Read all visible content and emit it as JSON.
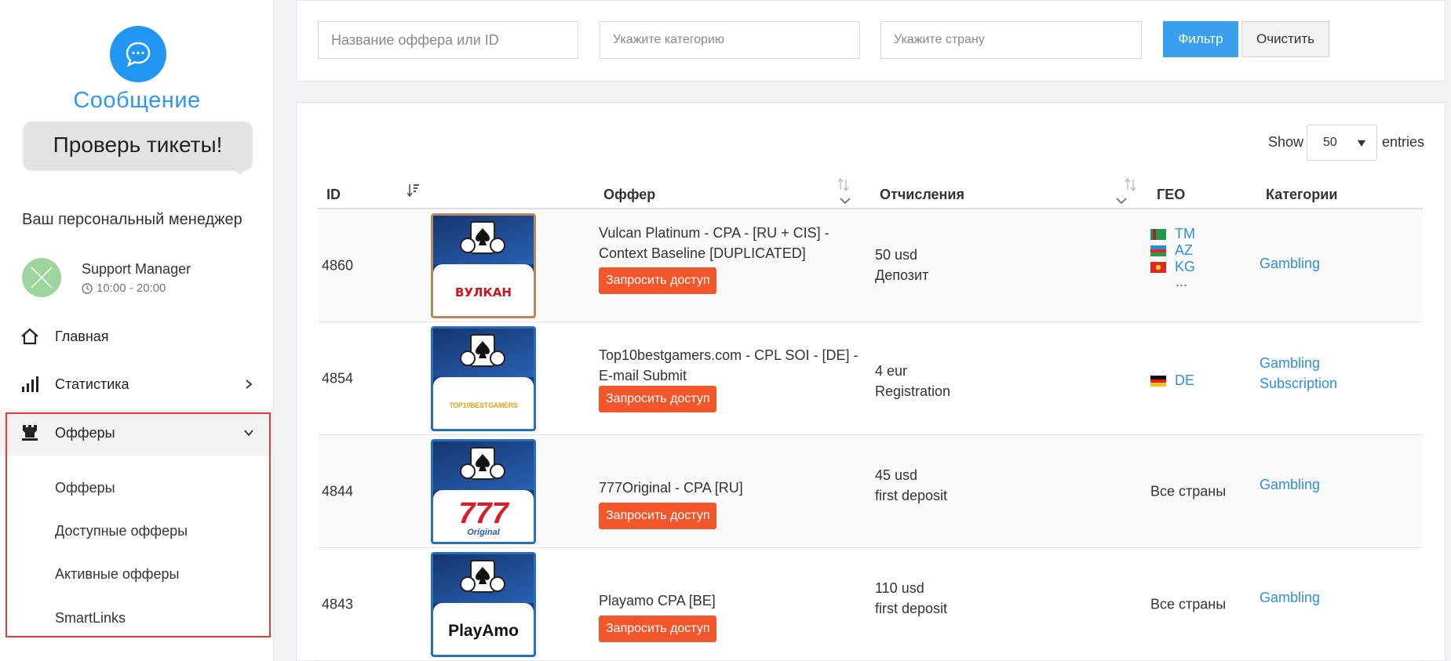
{
  "sidebar": {
    "message_title": "Сообщение",
    "ticket_bubble": "Проверь тикеты!",
    "manager_heading": "Ваш персональный менеджер",
    "manager": {
      "name": "Support Manager",
      "hours": "10:00 - 20:00"
    },
    "nav": [
      {
        "label": "Главная",
        "icon": "home-icon"
      },
      {
        "label": "Статистика",
        "icon": "stats-bars-icon"
      },
      {
        "label": "Офферы",
        "icon": "rook-icon",
        "expanded": true
      }
    ],
    "submenu": [
      "Офферы",
      "Доступные офферы",
      "Активные офферы",
      "SmartLinks"
    ]
  },
  "filters": {
    "name_placeholder": "Название оффера или ID",
    "category_placeholder": "Укажите категорию",
    "country_placeholder": "Укажите страну",
    "filter_button": "Фильтр",
    "clear_button": "Очистить"
  },
  "table": {
    "show_label": "Show",
    "entries_value": "50",
    "entries_label": "entries",
    "headers": {
      "id": "ID",
      "offer": "Оффер",
      "payout": "Отчисления",
      "geo": "ГЕО",
      "categories": "Категории"
    },
    "request_label": "Запросить доступ",
    "rows": [
      {
        "id": "4860",
        "logo_text": "ВУЛКАН",
        "offer": "Vulcan Platinum - CPA - [RU + CIS] - Context Baseline [DUPLICATED]",
        "payout_amount": "50 usd",
        "payout_type": "Депозит",
        "geo": [
          "TM",
          "AZ",
          "KG"
        ],
        "geo_more": "...",
        "categories": [
          "Gambling"
        ]
      },
      {
        "id": "4854",
        "logo_text": "TOP10BESTGAMERS",
        "offer": "Top10bestgamers.com - CPL SOI - [DE] - E-mail Submit",
        "payout_amount": "4 eur",
        "payout_type": "Registration",
        "geo": [
          "DE"
        ],
        "categories": [
          "Gambling",
          "Subscription"
        ]
      },
      {
        "id": "4844",
        "logo_text": "777",
        "logo_subtext": "Original",
        "offer": "777Original - CPA [RU]",
        "payout_amount": "45 usd",
        "payout_type": "first deposit",
        "geo_all": "Все страны",
        "categories": [
          "Gambling"
        ]
      },
      {
        "id": "4843",
        "logo_text": "PlayAmo",
        "offer": "Playamo CPA [BE]",
        "payout_amount": "110 usd",
        "payout_type": "first deposit",
        "geo_all": "Все страны",
        "categories": [
          "Gambling"
        ]
      }
    ]
  },
  "colors": {
    "accent_blue": "#3aa0ee",
    "request_orange": "#f2572b",
    "link_blue": "#2f8fdc",
    "highlight_red": "#e53935"
  }
}
